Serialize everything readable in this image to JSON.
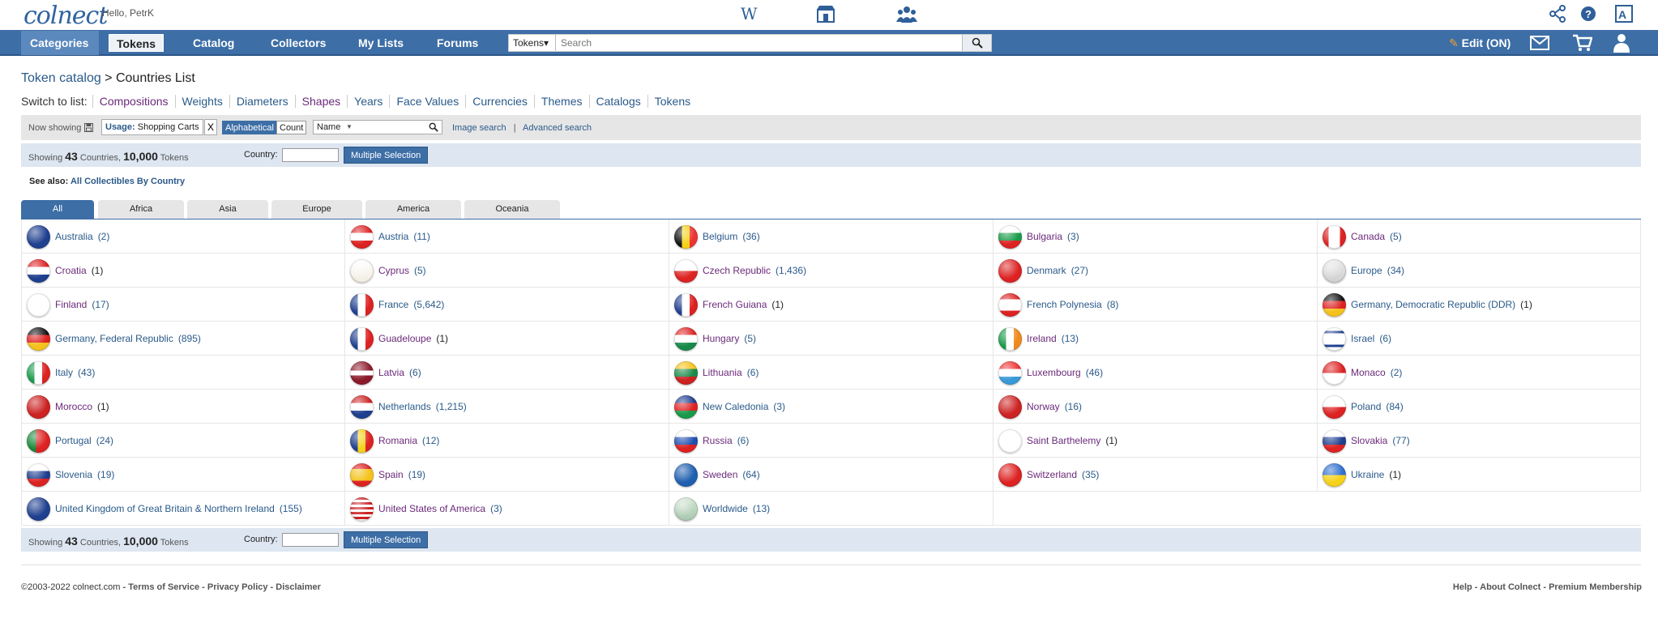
{
  "header": {
    "logo": "colnect",
    "greeting": "Hello, PetrK"
  },
  "nav": {
    "categories": "Categories ▼",
    "tokens": "Tokens",
    "catalog": "Catalog",
    "collectors": "Collectors",
    "my_lists": "My Lists",
    "forums": "Forums",
    "search_scope": "Tokens▾",
    "search_placeholder": "Search",
    "edit": "Edit (ON)"
  },
  "breadcrumb": {
    "parent": "Token catalog",
    "sep": " > ",
    "current": "Countries List"
  },
  "switch_list": {
    "label": "Switch to list:",
    "items": [
      "Compositions",
      "Weights",
      "Diameters",
      "Shapes",
      "Years",
      "Face Values",
      "Currencies",
      "Themes",
      "Catalogs",
      "Tokens"
    ]
  },
  "filter": {
    "now_showing": "Now showing",
    "usage_key": "Usage:",
    "usage_value": "Shopping Carts",
    "remove": "X",
    "alphabetical": "Alphabetical",
    "count": "Count",
    "sort": "Name",
    "image_search": "Image search",
    "separator": "|",
    "advanced_search": "Advanced search"
  },
  "showing": {
    "prefix": "Showing",
    "countries_n": "43",
    "countries": "Countries,",
    "tokens_n": "10,000",
    "tokens": "Tokens",
    "country_label": "Country:",
    "multiple": "Multiple Selection"
  },
  "see_also": {
    "label": "See also:",
    "link": "All Collectibles By Country"
  },
  "tabs": [
    "All",
    "Africa",
    "Asia",
    "Europe",
    "America",
    "Oceania"
  ],
  "countries": [
    {
      "name": "Australia",
      "count": "(2)",
      "visited": false
    },
    {
      "name": "Austria",
      "count": "(11)",
      "visited": false
    },
    {
      "name": "Belgium",
      "count": "(36)",
      "visited": false
    },
    {
      "name": "Bulgaria",
      "count": "(3)",
      "visited": true
    },
    {
      "name": "Canada",
      "count": "(5)",
      "visited": true
    },
    {
      "name": "Croatia",
      "count": "(1)",
      "visited": true
    },
    {
      "name": "Cyprus",
      "count": "(5)",
      "visited": true
    },
    {
      "name": "Czech Republic",
      "count": "(1,436)",
      "visited": true
    },
    {
      "name": "Denmark",
      "count": "(27)",
      "visited": false
    },
    {
      "name": "Europe",
      "count": "(34)",
      "visited": false
    },
    {
      "name": "Finland",
      "count": "(17)",
      "visited": true
    },
    {
      "name": "France",
      "count": "(5,642)",
      "visited": false
    },
    {
      "name": "French Guiana",
      "count": "(1)",
      "visited": true
    },
    {
      "name": "French Polynesia",
      "count": "(8)",
      "visited": false
    },
    {
      "name": "Germany, Democratic Republic (DDR)",
      "count": "(1)",
      "visited": false
    },
    {
      "name": "Germany, Federal Republic",
      "count": "(895)",
      "visited": false
    },
    {
      "name": "Guadeloupe",
      "count": "(1)",
      "visited": true
    },
    {
      "name": "Hungary",
      "count": "(5)",
      "visited": true
    },
    {
      "name": "Ireland",
      "count": "(13)",
      "visited": true
    },
    {
      "name": "Israel",
      "count": "(6)",
      "visited": false
    },
    {
      "name": "Italy",
      "count": "(43)",
      "visited": false
    },
    {
      "name": "Latvia",
      "count": "(6)",
      "visited": true
    },
    {
      "name": "Lithuania",
      "count": "(6)",
      "visited": true
    },
    {
      "name": "Luxembourg",
      "count": "(46)",
      "visited": true
    },
    {
      "name": "Monaco",
      "count": "(2)",
      "visited": true
    },
    {
      "name": "Morocco",
      "count": "(1)",
      "visited": true
    },
    {
      "name": "Netherlands",
      "count": "(1,215)",
      "visited": false
    },
    {
      "name": "New Caledonia",
      "count": "(3)",
      "visited": false
    },
    {
      "name": "Norway",
      "count": "(16)",
      "visited": true
    },
    {
      "name": "Poland",
      "count": "(84)",
      "visited": false
    },
    {
      "name": "Portugal",
      "count": "(24)",
      "visited": false
    },
    {
      "name": "Romania",
      "count": "(12)",
      "visited": true
    },
    {
      "name": "Russia",
      "count": "(6)",
      "visited": true
    },
    {
      "name": "Saint Barthelemy",
      "count": "(1)",
      "visited": true
    },
    {
      "name": "Slovakia",
      "count": "(77)",
      "visited": true
    },
    {
      "name": "Slovenia",
      "count": "(19)",
      "visited": false
    },
    {
      "name": "Spain",
      "count": "(19)",
      "visited": true
    },
    {
      "name": "Sweden",
      "count": "(64)",
      "visited": true
    },
    {
      "name": "Switzerland",
      "count": "(35)",
      "visited": true
    },
    {
      "name": "Ukraine",
      "count": "(1)",
      "visited": false
    },
    {
      "name": "United Kingdom of Great Britain & Northern Ireland",
      "count": "(155)",
      "visited": false
    },
    {
      "name": "United States of America",
      "count": "(3)",
      "visited": true
    },
    {
      "name": "Worldwide",
      "count": "(13)",
      "visited": false
    }
  ],
  "footer": {
    "copyright": "©2003-2022 colnect.com",
    "terms": "Terms of Service",
    "privacy": "Privacy Policy",
    "disclaimer": "Disclaimer",
    "help": "Help",
    "about": "About Colnect",
    "premium": "Premium Membership",
    "dash": " - "
  },
  "colors": {
    "nav": "#3d6ea6",
    "link": "#2a5a8a",
    "visited": "#6b2a7a",
    "showbar": "#dde6f1"
  }
}
